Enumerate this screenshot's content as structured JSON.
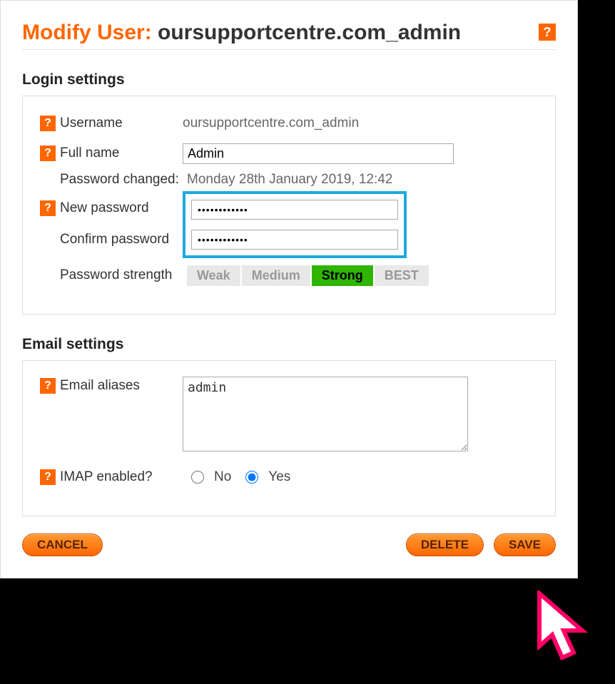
{
  "title": {
    "prefix": "Modify User: ",
    "suffix": "oursupportcentre.com_admin"
  },
  "sections": {
    "login": "Login settings",
    "email": "Email settings"
  },
  "login": {
    "username_label": "Username",
    "username_value": "oursupportcentre.com_admin",
    "fullname_label": "Full name",
    "fullname_value": "Admin",
    "pwchanged_label": "Password changed:",
    "pwchanged_value": "Monday 28th January 2019, 12:42",
    "newpw_label": "New password",
    "newpw_value": "••••••••••••",
    "confirmpw_label": "Confirm password",
    "confirmpw_value": "••••••••••••",
    "strength_label": "Password strength",
    "strength": {
      "weak": "Weak",
      "medium": "Medium",
      "strong": "Strong",
      "best": "BEST",
      "active": "strong"
    }
  },
  "email": {
    "aliases_label": "Email aliases",
    "aliases_value": "admin",
    "imap_label": "IMAP enabled?",
    "imap_no": "No",
    "imap_yes": "Yes",
    "imap_selected": "yes"
  },
  "buttons": {
    "cancel": "CANCEL",
    "delete": "DELETE",
    "save": "SAVE"
  },
  "help_glyph": "?"
}
